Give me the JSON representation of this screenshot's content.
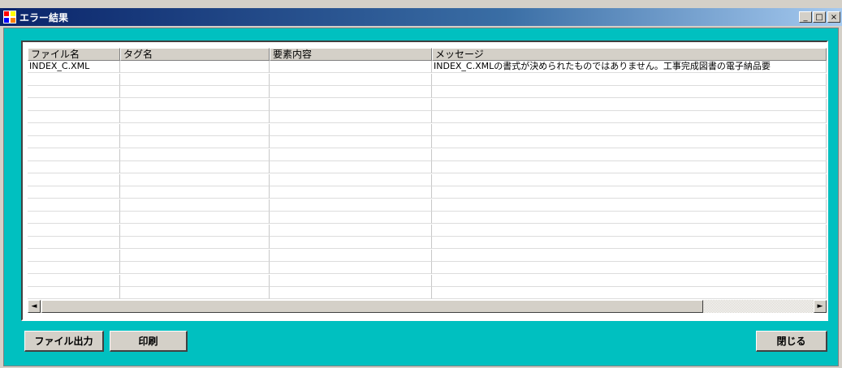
{
  "window": {
    "title": "エラー結果",
    "controls": {
      "minimize": "_",
      "maximize": "□",
      "close": "×"
    }
  },
  "grid": {
    "columns": [
      "ファイル名",
      "タグ名",
      "要素内容",
      "メッセージ"
    ],
    "rows": [
      [
        "INDEX_C.XML",
        "",
        "",
        "INDEX_C.XMLの書式が決められたものではありません。工事完成図書の電子納品要"
      ]
    ],
    "empty_row_count": 18
  },
  "scrollbar": {
    "left_arrow": "◄",
    "right_arrow": "►"
  },
  "buttons": {
    "export_label": "ファイル出力",
    "print_label": "印刷",
    "close_label": "閉じる"
  },
  "colors": {
    "client_background": "#00c0c0",
    "titlebar_start": "#0a246a"
  }
}
